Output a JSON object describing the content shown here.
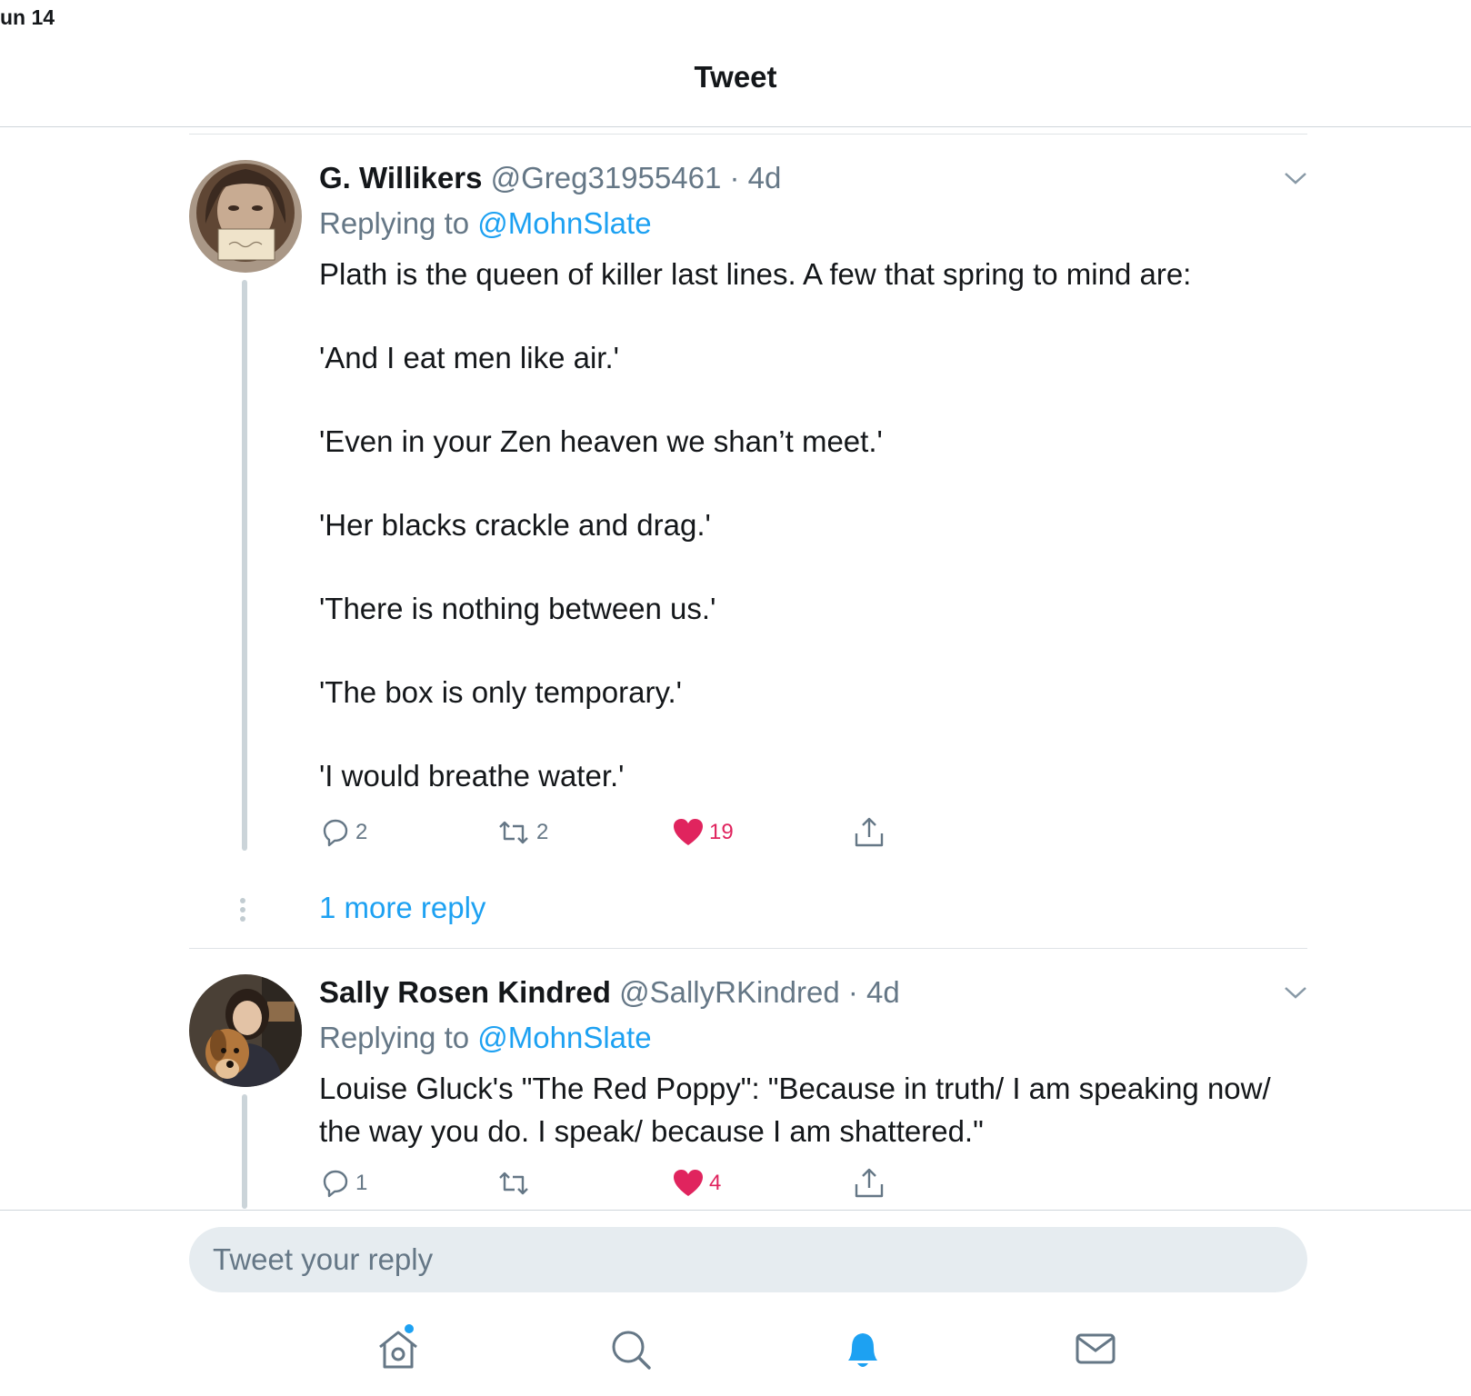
{
  "status_bar": {
    "time": "un 14"
  },
  "header": {
    "title": "Tweet"
  },
  "tweets": [
    {
      "name": "G. Willikers",
      "handle": "@Greg31955461",
      "separator": "·",
      "time": "4d",
      "replying_prefix": "Replying to",
      "replying_to": "@MohnSlate",
      "lines": [
        "Plath is the queen of killer last lines. A few that spring to mind are:",
        "'And I eat men like air.'",
        "'Even in your Zen heaven we shan’t meet.'",
        "'Her blacks crackle and drag.'",
        "'There is nothing between us.'",
        "'The box is only temporary.'",
        "'I would breathe water.'"
      ],
      "reply_count": "2",
      "retweet_count": "2",
      "like_count": "19"
    },
    {
      "name": "Sally Rosen Kindred",
      "handle": "@SallyRKindred",
      "separator": "·",
      "time": "4d",
      "replying_prefix": "Replying to",
      "replying_to": "@MohnSlate",
      "lines": [
        "Louise Gluck's \"The Red Poppy\": \"Because in truth/ I am speaking now/ the way you do. I speak/ because I am shattered.\""
      ],
      "reply_count": "1",
      "retweet_count": "",
      "like_count": "4"
    }
  ],
  "more_replies": "1 more reply",
  "reply_box": {
    "placeholder": "Tweet your reply"
  },
  "tab_bar": {
    "items": [
      "home-icon",
      "search-icon",
      "notifications-icon",
      "messages-icon"
    ],
    "active": "notifications-icon"
  },
  "colors": {
    "accent": "#1da1f2",
    "like": "#e0245e",
    "secondary_text": "#657786"
  }
}
